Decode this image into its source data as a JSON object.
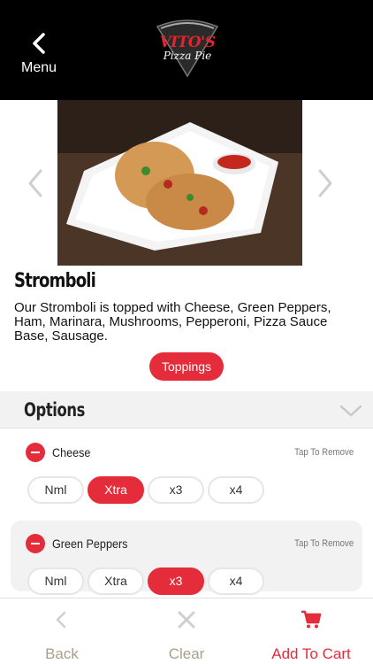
{
  "header": {
    "back_label": "Menu",
    "logo_brand": "VITO'S",
    "logo_sub": "Pizza Pie"
  },
  "product": {
    "name": "Stromboli",
    "description": "Our Stromboli is topped with Cheese, Green Peppers, Ham, Marinara, Mushrooms, Pepperoni, Pizza Sauce Base, Sausage.",
    "toppings_label": "Toppings"
  },
  "options": {
    "section_title": "Options",
    "items": [
      {
        "name": "Cheese",
        "remove_hint": "Tap To Remove",
        "choices": [
          "Nml",
          "Xtra",
          "x3",
          "x4"
        ],
        "selected": "Xtra"
      },
      {
        "name": "Green Peppers",
        "remove_hint": "Tap To Remove",
        "choices": [
          "Nml",
          "Xtra",
          "x3",
          "x4"
        ],
        "selected": "x3"
      }
    ]
  },
  "bottom_bar": {
    "back_label": "Back",
    "clear_label": "Clear",
    "cart_label": "Add To Cart"
  },
  "colors": {
    "accent": "#e52c3a",
    "header_bg": "#000000",
    "muted_label": "#a8a08a"
  }
}
